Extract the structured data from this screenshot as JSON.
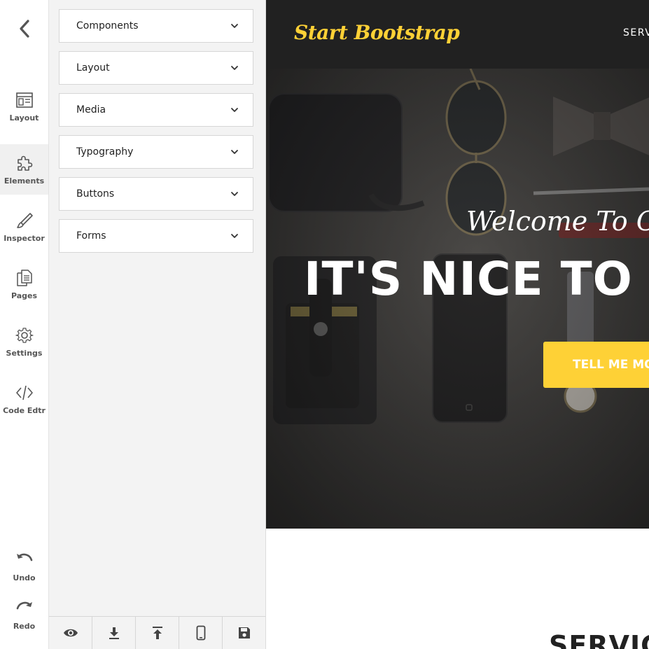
{
  "rail": {
    "items": [
      {
        "label": "Layout",
        "icon": "layout-icon"
      },
      {
        "label": "Elements",
        "icon": "puzzle-icon",
        "active": true
      },
      {
        "label": "Inspector",
        "icon": "brush-icon"
      },
      {
        "label": "Pages",
        "icon": "pages-icon"
      },
      {
        "label": "Settings",
        "icon": "gear-icon"
      },
      {
        "label": "Code Edtr",
        "icon": "code-icon"
      }
    ],
    "undo_label": "Undo",
    "redo_label": "Redo"
  },
  "panel": {
    "sections": [
      "Components",
      "Layout",
      "Media",
      "Typography",
      "Buttons",
      "Forms"
    ]
  },
  "toolbar": {
    "icons": [
      "eye-icon",
      "download-icon",
      "upload-icon",
      "mobile-icon",
      "save-icon"
    ]
  },
  "preview": {
    "brand": "Start Bootstrap",
    "nav_link": "SERV",
    "welcome": "Welcome To O",
    "headline": "IT'S NICE TO",
    "cta": "TELL ME MO",
    "section_title": "SERVIC"
  },
  "colors": {
    "accent": "#fed136",
    "navbar": "#212121",
    "panel": "#f3f3f3"
  }
}
